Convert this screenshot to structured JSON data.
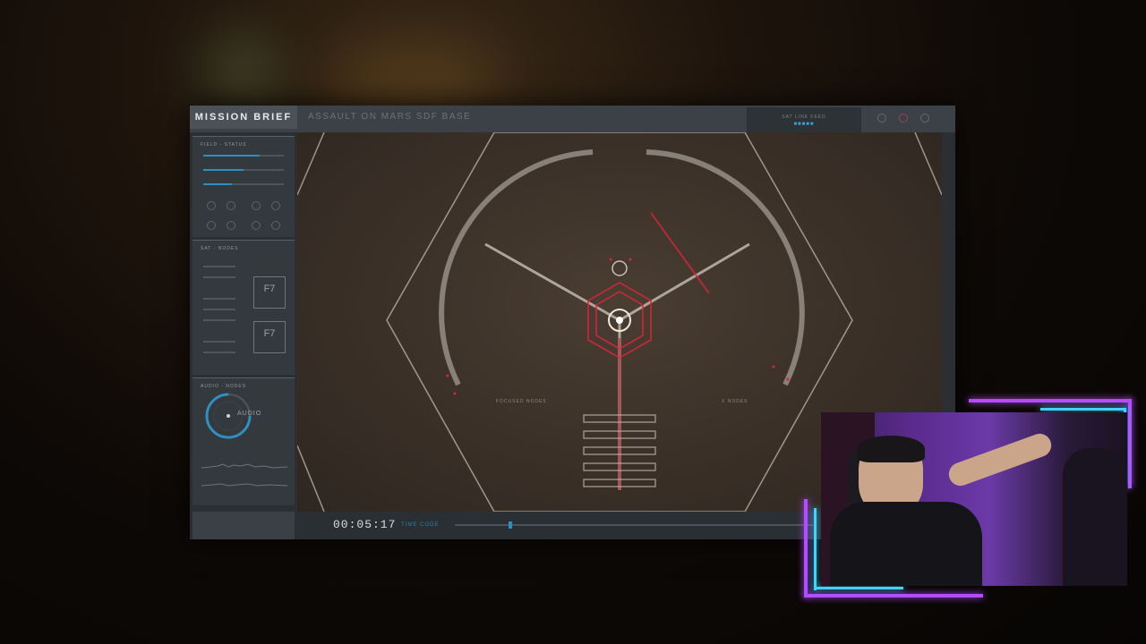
{
  "mission_brief": {
    "title": "MISSION BRIEF",
    "subtitle": "ASSAULT ON MARS SDF BASE",
    "feed_label": "SAT LINK FEED"
  },
  "left_panel": {
    "field_status": {
      "header": "FIELD - STATUS",
      "bars": [
        {
          "fill": 0.7
        },
        {
          "fill": 0.5
        },
        {
          "fill": 0.35
        }
      ]
    },
    "sat_nodes": {
      "header": "SAT - NODES",
      "boxes": [
        "F7",
        "F7"
      ]
    },
    "audio_nodes": {
      "header": "AUDIO - NODES",
      "dial_label": "AUDIO"
    }
  },
  "map": {
    "label_left": "FOCUSED NODES",
    "label_right": "X NODES"
  },
  "timeline": {
    "time": "00:05:17",
    "timecode_label": "TIME CODE",
    "progress": 0.15
  },
  "colors": {
    "accent": "#2f8fc0",
    "target": "#d8253a",
    "neon_purple": "#b34cff",
    "neon_cyan": "#3fd4ff"
  }
}
